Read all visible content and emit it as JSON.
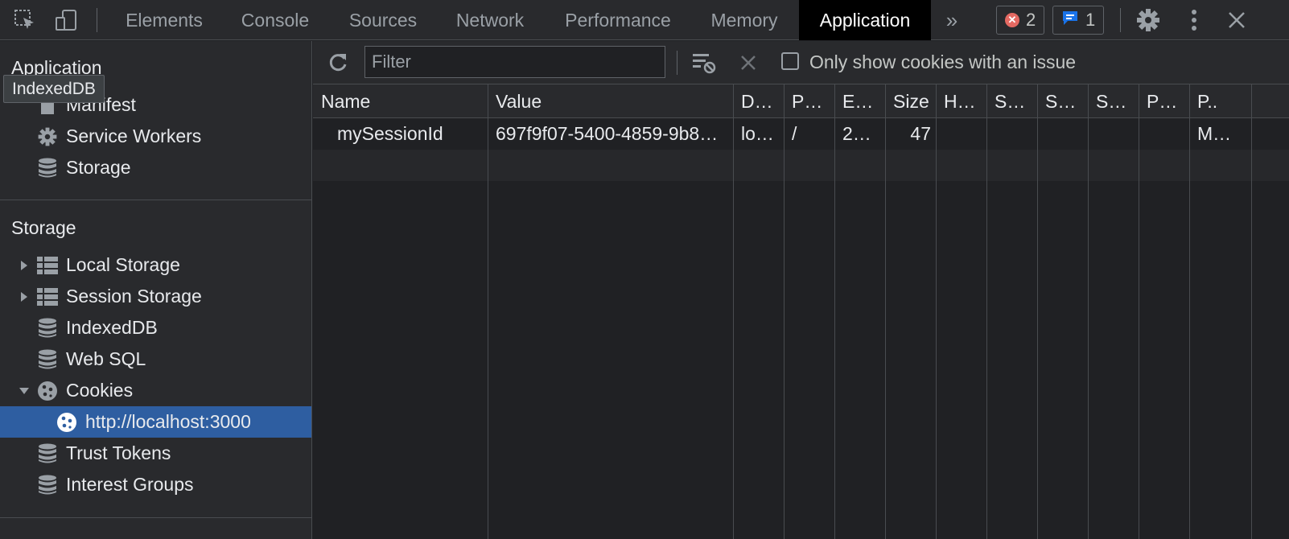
{
  "toolbar": {
    "tabs": [
      "Elements",
      "Console",
      "Sources",
      "Network",
      "Performance",
      "Memory",
      "Application"
    ],
    "active_tab": "Application",
    "error_count": "2",
    "message_count": "1"
  },
  "sidebar": {
    "app_section_title": "Application",
    "tooltip": "IndexedDB",
    "app_items": [
      "Manifest",
      "Service Workers",
      "Storage"
    ],
    "storage_section_title": "Storage",
    "storage_items": [
      "Local Storage",
      "Session Storage",
      "IndexedDB",
      "Web SQL",
      "Cookies",
      "http://localhost:3000",
      "Trust Tokens",
      "Interest Groups"
    ]
  },
  "filterbar": {
    "filter_placeholder": "Filter",
    "only_issues_label": "Only show cookies with an issue"
  },
  "table": {
    "headers": [
      "Name",
      "Value",
      "D…",
      "P…",
      "E…",
      "Size",
      "H…",
      "S…",
      "S…",
      "S…",
      "P…",
      "P.."
    ],
    "rows": [
      [
        "mySessionId",
        "697f9f07-5400-4859-9b8…",
        "lo…",
        "/",
        "2…",
        "47",
        "",
        "",
        "",
        "",
        "",
        "M…"
      ]
    ]
  },
  "colors": {
    "background": "#202124",
    "panel": "#292a2d",
    "selected": "#2e5ea1",
    "error": "#e46962",
    "info": "#1a73e8"
  }
}
